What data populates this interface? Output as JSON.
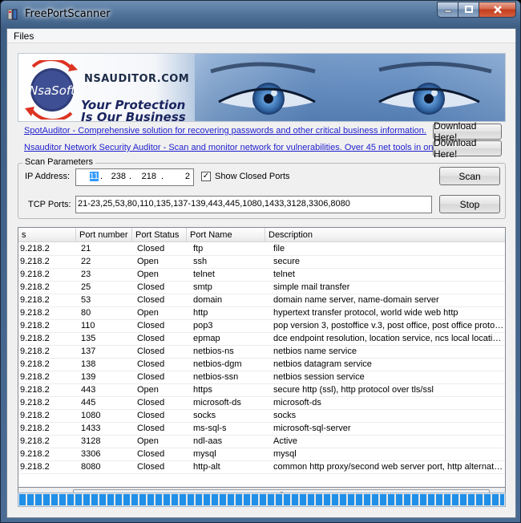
{
  "window": {
    "title": "FreePortScanner"
  },
  "menu": {
    "files": "Files"
  },
  "banner": {
    "logo_text": "NsaSoft",
    "site": "NSAUDITOR.COM",
    "tagline_line1": "Your Protection",
    "tagline_line2": "Is Our Business"
  },
  "links": [
    {
      "text": "SpotAuditor - Comprehensive solution for recovering passwords and other critical business information.",
      "button": "Download Here!"
    },
    {
      "text": "Nsauditor Network Security Auditor - Scan and monitor network for vulnerabilities. Over 45 net tools in one.",
      "button": "Download Here!"
    }
  ],
  "scan_params": {
    "title": "Scan Parameters",
    "ip_label": "IP Address:",
    "ip_octets": [
      "11",
      "238",
      "218",
      "2"
    ],
    "show_closed_label": "Show Closed Ports",
    "show_closed_checked": true,
    "check_mark": "✓",
    "scan_button": "Scan",
    "stop_button": "Stop",
    "tcp_label": "TCP Ports:",
    "tcp_ports": "21-23,25,53,80,110,135,137-139,443,445,1080,1433,3128,3306,8080"
  },
  "table": {
    "columns": [
      "s",
      "Port number",
      "Port Status",
      "Port Name",
      "Description"
    ],
    "rows": [
      [
        "9.218.2",
        "21",
        "Closed",
        "ftp",
        "file"
      ],
      [
        "9.218.2",
        "22",
        "Open",
        "ssh",
        "secure"
      ],
      [
        "9.218.2",
        "23",
        "Open",
        "telnet",
        "telnet"
      ],
      [
        "9.218.2",
        "25",
        "Closed",
        "smtp",
        "simple mail transfer"
      ],
      [
        "9.218.2",
        "53",
        "Closed",
        "domain",
        "domain name server, name-domain server"
      ],
      [
        "9.218.2",
        "80",
        "Open",
        "http",
        "hypertext transfer protocol, world wide web http"
      ],
      [
        "9.218.2",
        "110",
        "Closed",
        "pop3",
        "pop version 3, postoffice v.3, post office, post office protoc..."
      ],
      [
        "9.218.2",
        "135",
        "Closed",
        "epmap",
        "dce endpoint resolution, location service, ncs local location..."
      ],
      [
        "9.218.2",
        "137",
        "Closed",
        "netbios-ns",
        "netbios name service"
      ],
      [
        "9.218.2",
        "138",
        "Closed",
        "netbios-dgm",
        "netbios datagram service"
      ],
      [
        "9.218.2",
        "139",
        "Closed",
        "netbios-ssn",
        "netbios session service"
      ],
      [
        "9.218.2",
        "443",
        "Open",
        "https",
        "secure http (ssl), http protocol over tls/ssl"
      ],
      [
        "9.218.2",
        "445",
        "Closed",
        "microsoft-ds",
        "microsoft-ds"
      ],
      [
        "9.218.2",
        "1080",
        "Closed",
        "socks",
        "socks"
      ],
      [
        "9.218.2",
        "1433",
        "Closed",
        "ms-sql-s",
        "microsoft-sql-server"
      ],
      [
        "9.218.2",
        "3128",
        "Open",
        "ndl-aas",
        "Active"
      ],
      [
        "9.218.2",
        "3306",
        "Closed",
        "mysql",
        "mysql"
      ],
      [
        "9.218.2",
        "8080",
        "Closed",
        "http-alt",
        "common http proxy/second web server port, http alternate (..."
      ]
    ]
  },
  "scrollbar": {
    "left_arrow": "◀",
    "right_arrow": "▶",
    "grip": "|||"
  },
  "progress": {
    "fraction": 1.0,
    "color": "#1f8fe8"
  }
}
